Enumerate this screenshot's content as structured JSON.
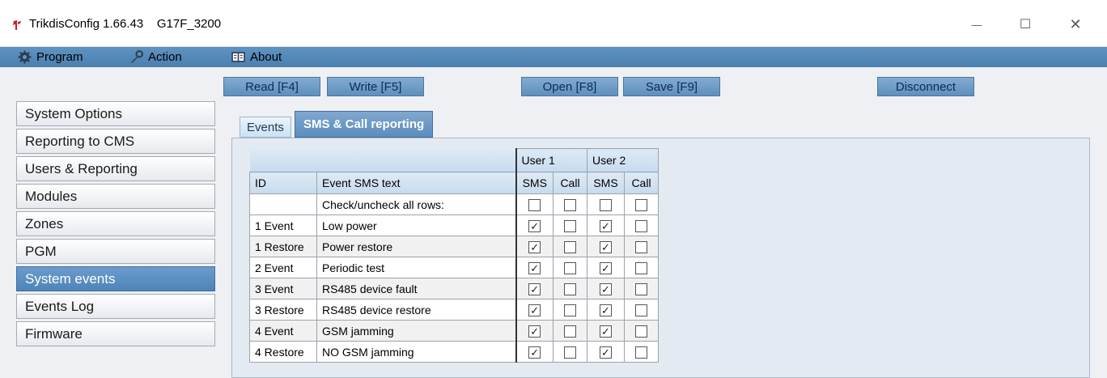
{
  "window": {
    "title": "TrikdisConfig 1.66.43    G17F_3200",
    "minimize_glyph": "—",
    "maximize_glyph": "☐",
    "close_glyph": "✕"
  },
  "menu": {
    "program": "Program",
    "action": "Action",
    "about": "About"
  },
  "toolbar": {
    "read": "Read [F4]",
    "write": "Write [F5]",
    "open": "Open [F8]",
    "save": "Save [F9]",
    "disconnect": "Disconnect"
  },
  "sidebar": {
    "items": [
      {
        "label": "System Options"
      },
      {
        "label": "Reporting to CMS"
      },
      {
        "label": "Users & Reporting"
      },
      {
        "label": "Modules"
      },
      {
        "label": "Zones"
      },
      {
        "label": "PGM"
      },
      {
        "label": "System events"
      },
      {
        "label": "Events Log"
      },
      {
        "label": "Firmware"
      }
    ],
    "active_index": 6
  },
  "tabs": {
    "events": "Events",
    "sms_call": "SMS & Call reporting"
  },
  "table": {
    "user1": "User 1",
    "user2": "User 2",
    "col_id": "ID",
    "col_text": "Event SMS text",
    "col_sms": "SMS",
    "col_call": "Call",
    "check_all_label": "Check/uncheck all rows:",
    "check_mark": "✓",
    "rows": [
      {
        "id": "1 Event",
        "text": "Low power",
        "u1_sms": true,
        "u1_call": false,
        "u2_sms": true,
        "u2_call": false
      },
      {
        "id": "1 Restore",
        "text": "Power restore",
        "u1_sms": true,
        "u1_call": false,
        "u2_sms": true,
        "u2_call": false
      },
      {
        "id": "2 Event",
        "text": "Periodic test",
        "u1_sms": true,
        "u1_call": false,
        "u2_sms": true,
        "u2_call": false
      },
      {
        "id": "3 Event",
        "text": "RS485 device fault",
        "u1_sms": true,
        "u1_call": false,
        "u2_sms": true,
        "u2_call": false
      },
      {
        "id": "3 Restore",
        "text": "RS485 device restore",
        "u1_sms": true,
        "u1_call": false,
        "u2_sms": true,
        "u2_call": false
      },
      {
        "id": "4 Event",
        "text": "GSM jamming",
        "u1_sms": true,
        "u1_call": false,
        "u2_sms": true,
        "u2_call": false
      },
      {
        "id": "4 Restore",
        "text": "NO GSM jamming",
        "u1_sms": true,
        "u1_call": false,
        "u2_sms": true,
        "u2_call": false
      }
    ]
  },
  "colors": {
    "menubar": "#5a8ebd",
    "accent": "#5c8dbd",
    "app_icon": "#c8212b"
  }
}
